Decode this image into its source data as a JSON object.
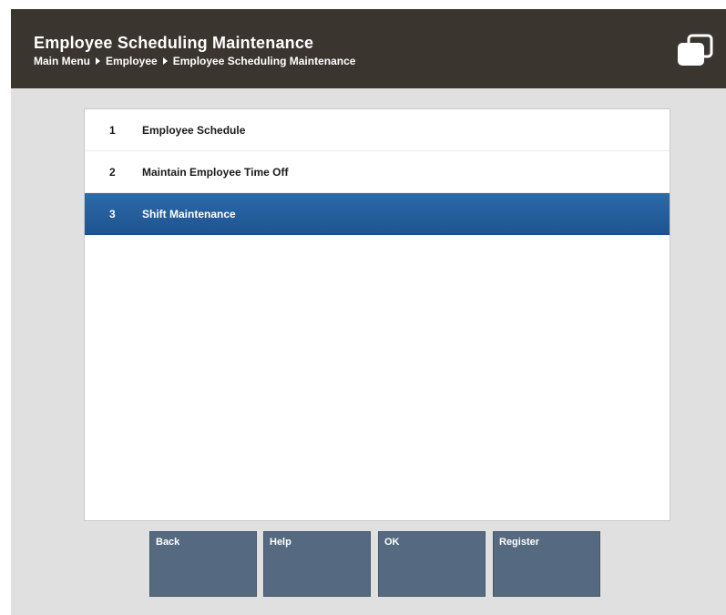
{
  "header": {
    "title": "Employee Scheduling Maintenance",
    "breadcrumb": [
      "Main Menu",
      "Employee",
      "Employee Scheduling Maintenance"
    ],
    "icon": "windows-icon"
  },
  "menu": {
    "items": [
      {
        "number": "1",
        "label": "Employee Schedule",
        "selected": false
      },
      {
        "number": "2",
        "label": "Maintain Employee Time Off",
        "selected": false
      },
      {
        "number": "3",
        "label": "Shift Maintenance",
        "selected": true
      }
    ],
    "selected_color": "#2462a0"
  },
  "buttons": {
    "back": "Back",
    "help": "Help",
    "ok": "OK",
    "register": "Register"
  },
  "colors": {
    "header_bg": "#3b3530",
    "button_bg": "#556a80",
    "page_bg": "#e0e0e0"
  }
}
